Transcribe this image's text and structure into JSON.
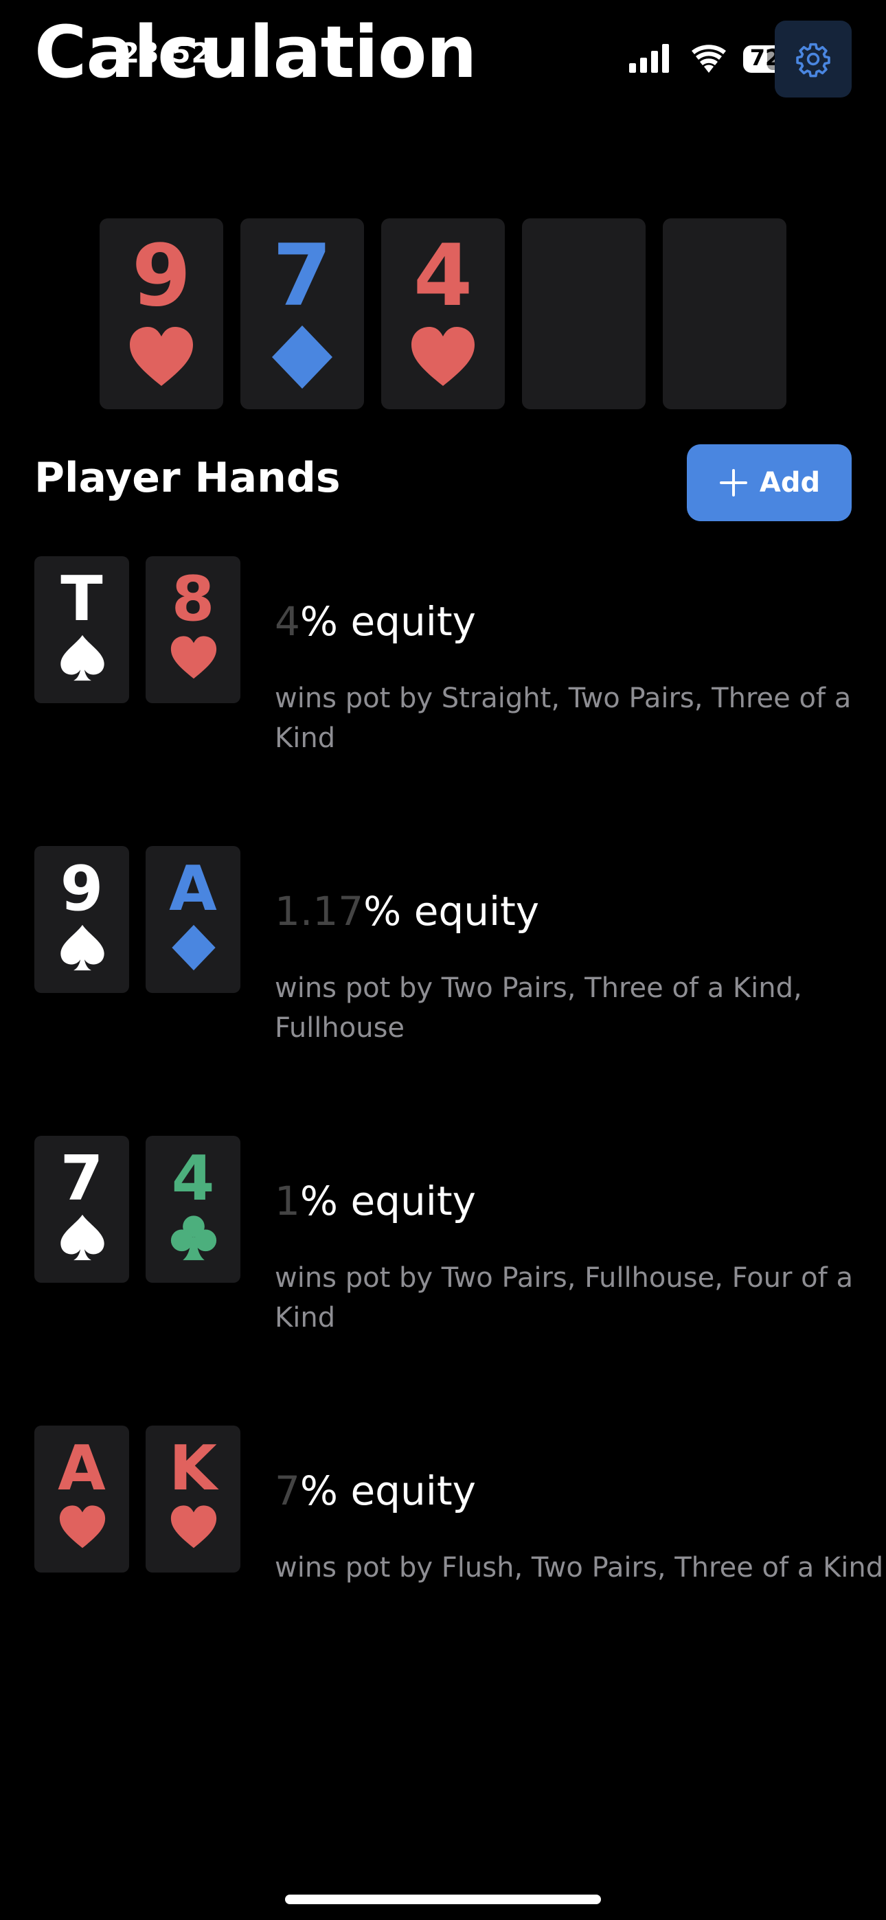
{
  "header": {
    "title": "Calculation",
    "status_time": "23:52",
    "battery_level": "72",
    "settings_icon": "gear-icon"
  },
  "colors": {
    "background": "#000000",
    "card_bg": "#1c1c1e",
    "hearts": "#e0625e",
    "diamonds": "#4a86e0",
    "clubs": "#4caf7d",
    "spades": "#ffffff",
    "accent": "#4a86e0",
    "muted_text": "#8e8e93"
  },
  "board": {
    "cards": [
      {
        "rank": "9",
        "suit": "hearts"
      },
      {
        "rank": "7",
        "suit": "diamonds"
      },
      {
        "rank": "4",
        "suit": "hearts"
      },
      {
        "rank": "",
        "suit": ""
      },
      {
        "rank": "",
        "suit": ""
      }
    ]
  },
  "player_hands": {
    "title": "Player Hands",
    "add_label": "Add",
    "players": [
      {
        "cards": [
          {
            "rank": "T",
            "suit": "spades"
          },
          {
            "rank": "8",
            "suit": "hearts"
          }
        ],
        "equity_value": "4",
        "equity_unit": "% equity",
        "wins_text": "wins pot by Straight, Two Pairs, Three of a Kind"
      },
      {
        "cards": [
          {
            "rank": "9",
            "suit": "spades"
          },
          {
            "rank": "A",
            "suit": "diamonds"
          }
        ],
        "equity_value": "1.17",
        "equity_unit": "% equity",
        "wins_text": "wins pot by Two Pairs, Three of a Kind, Fullhouse"
      },
      {
        "cards": [
          {
            "rank": "7",
            "suit": "spades"
          },
          {
            "rank": "4",
            "suit": "clubs"
          }
        ],
        "equity_value": "1",
        "equity_unit": "% equity",
        "wins_text": "wins pot by Two Pairs, Fullhouse, Four of a Kind"
      },
      {
        "cards": [
          {
            "rank": "A",
            "suit": "hearts"
          },
          {
            "rank": "K",
            "suit": "hearts"
          }
        ],
        "equity_value": "7",
        "equity_unit": "% equity",
        "wins_text": "wins pot by Flush, Two Pairs, Three of a Kind"
      }
    ]
  }
}
